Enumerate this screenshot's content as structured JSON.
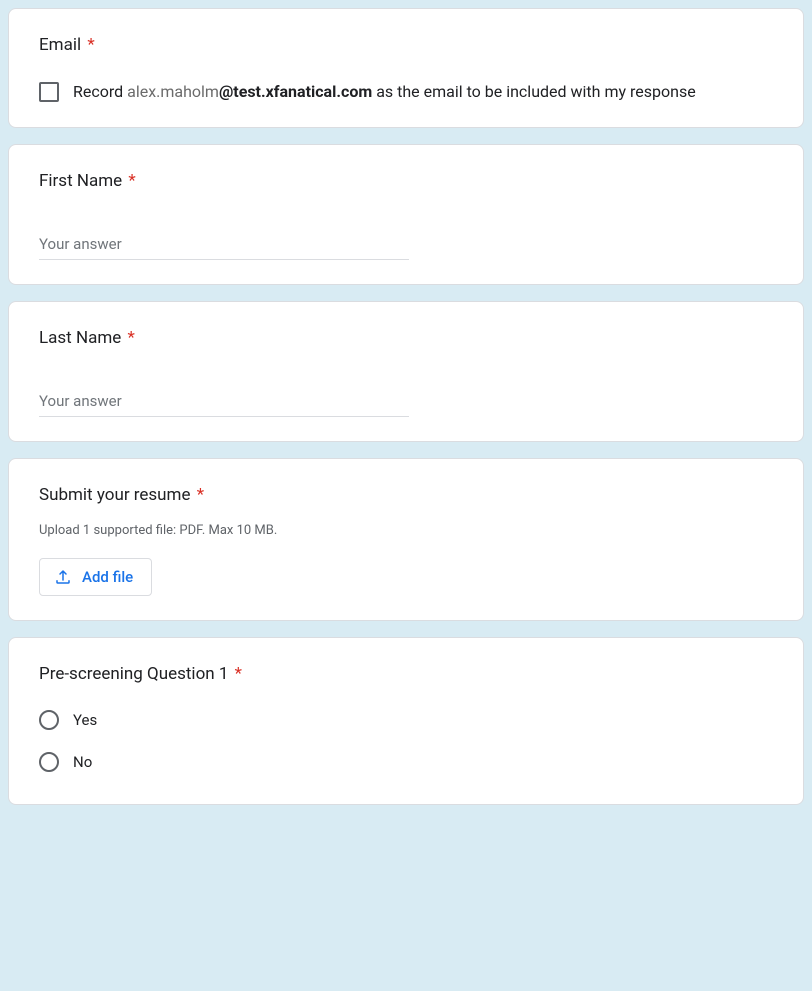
{
  "emailBlock": {
    "label": "Email",
    "record_prefix": "Record ",
    "email_user": "alex.maholm",
    "email_domain": "@test.xfanatical.com",
    "record_suffix": " as the email to be included with my response"
  },
  "firstName": {
    "label": "First Name",
    "placeholder": "Your answer"
  },
  "lastName": {
    "label": "Last Name",
    "placeholder": "Your answer"
  },
  "resume": {
    "label": "Submit your resume",
    "help": "Upload 1 supported file: PDF. Max 10 MB.",
    "add_file": "Add file"
  },
  "prescreen": {
    "label": "Pre-screening Question 1",
    "options": {
      "yes": "Yes",
      "no": "No"
    }
  },
  "required_mark": "*"
}
